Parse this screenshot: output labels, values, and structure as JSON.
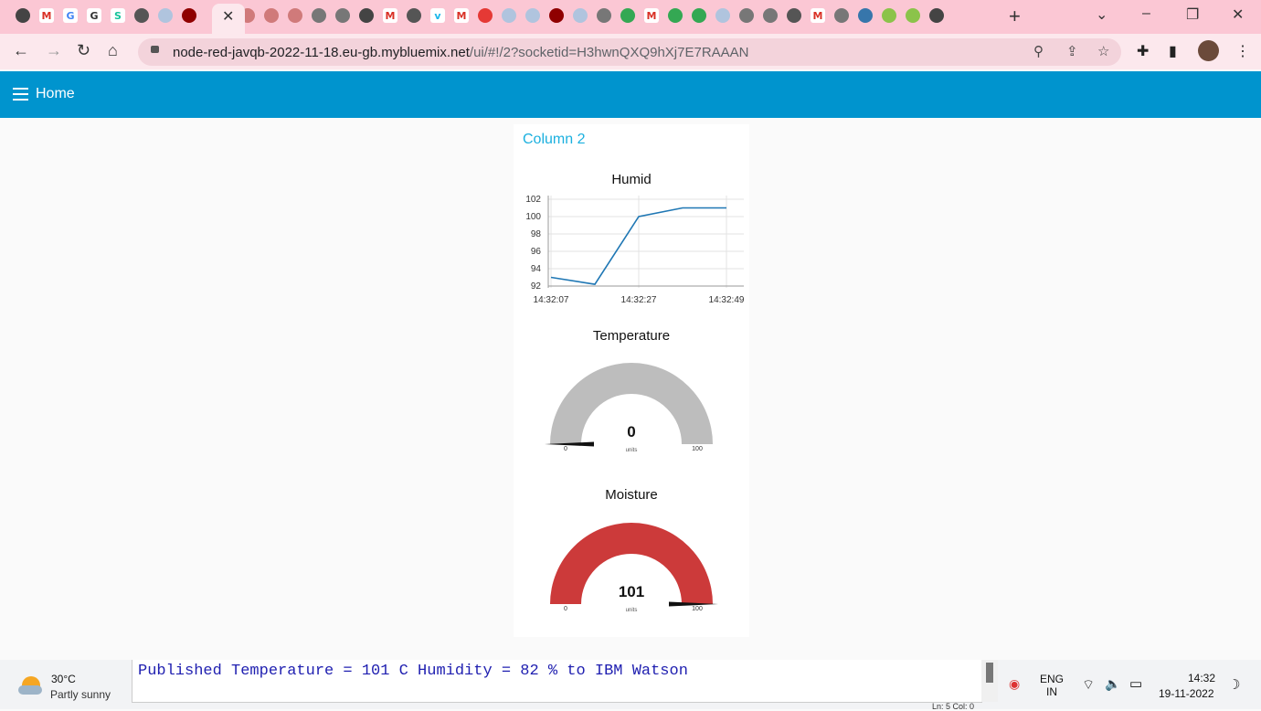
{
  "browser": {
    "tab_close_glyph": "✕",
    "new_tab_glyph": "+",
    "window_controls": {
      "dropdown": "⌄",
      "minimize": "–",
      "restore": "❐",
      "close": "✕"
    },
    "url_host": "node-red-javqb-2022-11-18.eu-gb.mybluemix.net",
    "url_path": "/ui/#!/2?socketid=H3hwnQXQ9hXj7E7RAAAN",
    "nav": {
      "back": "←",
      "forward": "→",
      "reload": "↻",
      "home": "⌂"
    },
    "omnibox_icons": {
      "zoom": "⚲",
      "share": "⇪",
      "bookmark": "☆"
    },
    "toolbar_icons": {
      "extensions": "✚",
      "sidepanel": "▮",
      "menu": "⋮"
    },
    "tab_icons": [
      {
        "name": "chrome-icon",
        "color": "#444"
      },
      {
        "name": "gmail-icon",
        "color": "#d93025",
        "glyph": "M"
      },
      {
        "name": "google-icon",
        "color": "#4285f4",
        "glyph": "G"
      },
      {
        "name": "grammarly-icon",
        "color": "#333",
        "glyph": "G"
      },
      {
        "name": "grammarly-icon",
        "color": "#15c39a",
        "glyph": "S"
      },
      {
        "name": "globe-icon",
        "color": "#555"
      },
      {
        "name": "cloud-icon",
        "color": "#b0c4de"
      },
      {
        "name": "nodered-icon",
        "color": "#8f0000"
      },
      {
        "name": "nodered-icon",
        "color": "#d07a7a"
      },
      {
        "name": "nodered-icon",
        "color": "#d07a7a"
      },
      {
        "name": "nodered-icon",
        "color": "#d07a7a"
      },
      {
        "name": "iot-icon",
        "color": "#777"
      },
      {
        "name": "iot-icon",
        "color": "#777"
      },
      {
        "name": "chrome-icon",
        "color": "#444"
      },
      {
        "name": "gmail-icon",
        "color": "#d93025",
        "glyph": "M"
      },
      {
        "name": "globe-icon",
        "color": "#555"
      },
      {
        "name": "vimeo-icon",
        "color": "#1ab7ea",
        "glyph": "v"
      },
      {
        "name": "gmail-icon",
        "color": "#d93025",
        "glyph": "M"
      },
      {
        "name": "heart-icon",
        "color": "#e53935"
      },
      {
        "name": "cloud-icon",
        "color": "#b0c4de"
      },
      {
        "name": "cloud-icon",
        "color": "#b0c4de"
      },
      {
        "name": "nodered-icon",
        "color": "#8f0000"
      },
      {
        "name": "cloud-icon",
        "color": "#b0c4de"
      },
      {
        "name": "iot-icon",
        "color": "#777"
      },
      {
        "name": "meet-icon",
        "color": "#34a853"
      },
      {
        "name": "gmail-icon",
        "color": "#d93025",
        "glyph": "M"
      },
      {
        "name": "meet-icon",
        "color": "#34a853"
      },
      {
        "name": "meet-icon",
        "color": "#34a853"
      },
      {
        "name": "cloud-icon",
        "color": "#b0c4de"
      },
      {
        "name": "iot-icon",
        "color": "#777"
      },
      {
        "name": "iot-icon",
        "color": "#777"
      },
      {
        "name": "globe-icon",
        "color": "#555"
      },
      {
        "name": "gmail-icon",
        "color": "#d93025",
        "glyph": "M"
      },
      {
        "name": "iot-icon",
        "color": "#777"
      },
      {
        "name": "python-icon",
        "color": "#3776ab"
      },
      {
        "name": "extension-icon",
        "color": "#8bc34a"
      },
      {
        "name": "extension-icon",
        "color": "#8bc34a"
      },
      {
        "name": "chrome-icon",
        "color": "#444"
      }
    ]
  },
  "dashboard": {
    "title": "Home",
    "header_color": "#0094ce",
    "group_title": "Column 2",
    "humid": {
      "title": "Humid"
    },
    "temperature": {
      "title": "Temperature",
      "value": "0",
      "units": "units",
      "min": "0",
      "max": "100",
      "fraction": 0.0,
      "color": "#bdbdbd"
    },
    "moisture": {
      "title": "Moisture",
      "value": "101",
      "units": "units",
      "min": "0",
      "max": "100",
      "fraction": 1.0,
      "color": "#cc3a3a"
    }
  },
  "chart_data": {
    "type": "line",
    "title": "Humid",
    "x": [
      "14:32:07",
      "14:32:17",
      "14:32:27",
      "14:32:37",
      "14:32:49"
    ],
    "xticks": [
      "14:32:07",
      "14:32:27",
      "14:32:49"
    ],
    "series": [
      {
        "values": [
          93,
          92.2,
          100,
          101,
          101
        ]
      }
    ],
    "yticks": [
      "102",
      "100",
      "98",
      "96",
      "94",
      "92"
    ],
    "ylim": [
      92,
      102
    ],
    "line_color": "#1f77b4",
    "grid": true
  },
  "taskbar": {
    "weather_temp": "30°C",
    "weather_cond": "Partly sunny",
    "console_text": "Published Temperature = 101 C Humidity = 82 % to IBM Watson",
    "console_status": "Ln: 5  Col: 0",
    "lang_1": "ENG",
    "lang_2": "IN",
    "time": "14:32",
    "date": "19-11-2022",
    "tray_icons": {
      "wifi": "⌔",
      "volume": "🔈",
      "battery": "▭",
      "moon": "☽"
    }
  }
}
